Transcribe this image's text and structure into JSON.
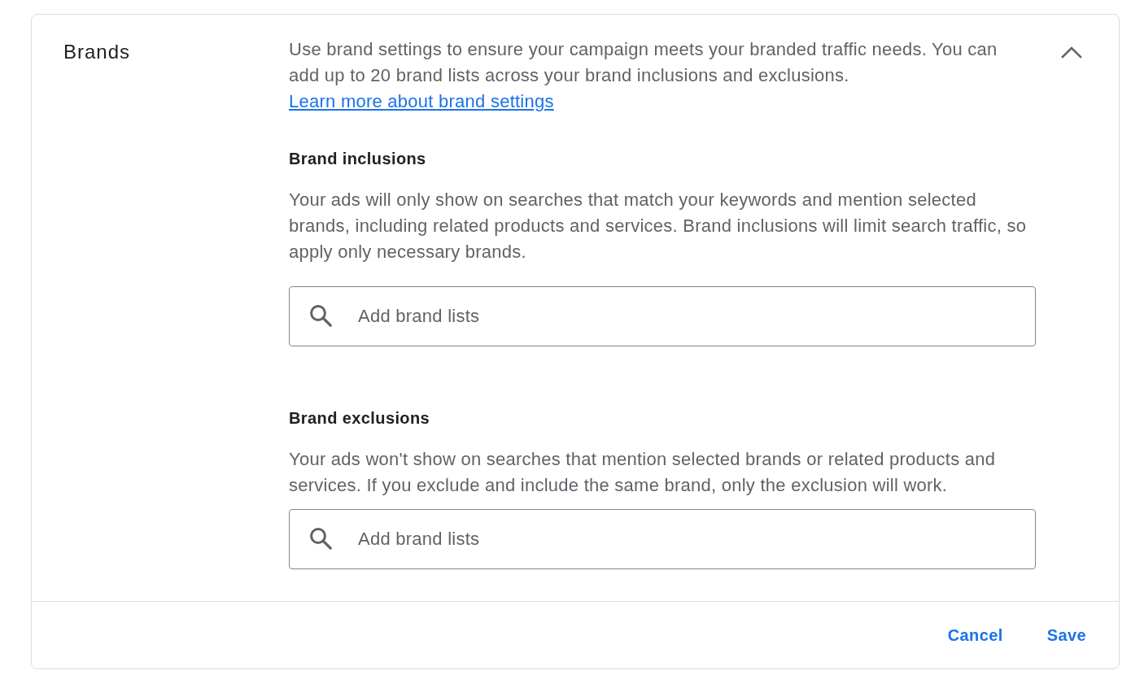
{
  "section": {
    "title": "Brands",
    "expanded": true,
    "description": "Use brand settings to ensure your campaign meets your branded traffic needs. You can add up to 20 brand lists across your brand inclusions and exclusions.",
    "link": "Learn more about brand settings",
    "groups": [
      {
        "heading": "Brand inclusions",
        "description": "Your ads will only show on searches that match your keywords and mention selected brands, including related products and services. Brand inclusions will limit search traffic, so apply only necessary brands.",
        "search": {
          "placeholder": "Add brand lists"
        }
      },
      {
        "heading": "Brand exclusions",
        "description": "Your ads won't show on searches that mention selected brands or related products and services. If you exclude and include the same brand, only the exclusion will work.",
        "search": {
          "placeholder": "Add brand lists"
        }
      }
    ]
  },
  "buttons": [
    {
      "label": "Cancel"
    },
    {
      "label": "Save"
    }
  ]
}
